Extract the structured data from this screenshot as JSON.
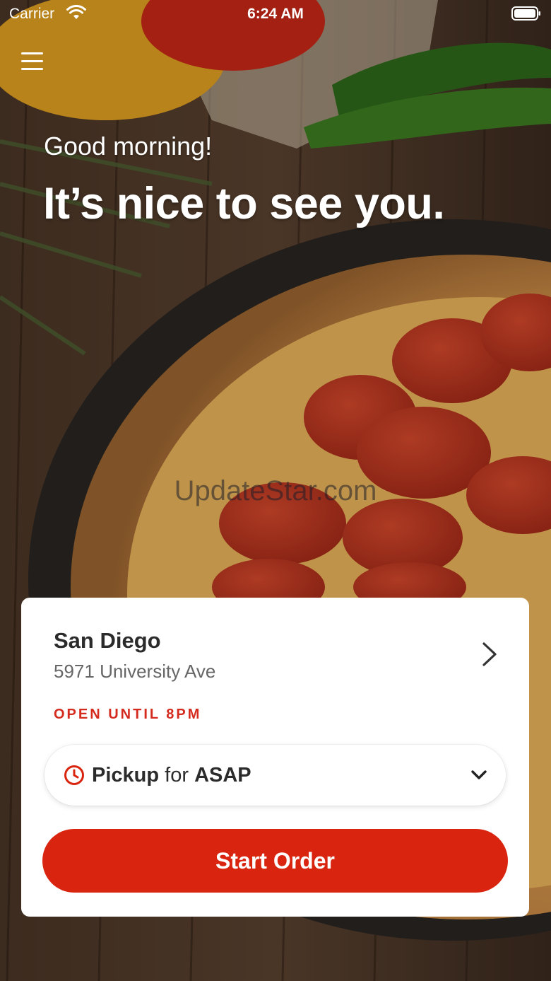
{
  "status_bar": {
    "carrier": "Carrier",
    "time": "6:24 AM"
  },
  "hero": {
    "greeting": "Good morning!",
    "headline": "It’s nice to see you.",
    "watermark": "UpdateStar.com"
  },
  "location": {
    "city": "San Diego",
    "address": "5971 University Ave",
    "hours": "OPEN UNTIL 8PM"
  },
  "order_mode": {
    "mode": "Pickup",
    "connector": "for",
    "time": "ASAP"
  },
  "actions": {
    "start_order": "Start Order"
  },
  "colors": {
    "accent": "#d9240f",
    "hours_text": "#d52b1e",
    "card_bg": "#ffffff"
  },
  "icons": [
    "hamburger-menu-icon",
    "wifi-icon",
    "battery-icon",
    "chevron-right-icon",
    "clock-icon",
    "chevron-down-icon"
  ]
}
